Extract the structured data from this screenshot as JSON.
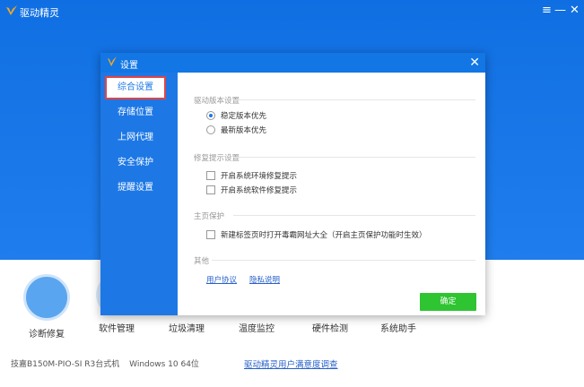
{
  "app": {
    "title": "驱动精灵",
    "window_controls": [
      "≡",
      "—",
      "✕"
    ],
    "features": [
      {
        "label": "诊断修复",
        "icon": "window-repair-icon",
        "color": "#5aa5ef"
      },
      {
        "label": "软件管理",
        "icon": "software-manage-icon",
        "color": "#e7f1fb"
      },
      {
        "label": "垃圾清理",
        "icon": "trash-clean-icon",
        "color": "#eef6ee"
      },
      {
        "label": "温度监控",
        "icon": "thermometer-icon",
        "color": "#f3eefb"
      },
      {
        "label": "硬件检测",
        "icon": "hardware-check-icon",
        "color": "#eaf2fb"
      },
      {
        "label": "系统助手",
        "icon": "system-assistant-icon",
        "color": "#f4eefa"
      }
    ],
    "status": {
      "board": "技嘉B150M-PIO-SI R3台式机",
      "os": "Windows 10 64位",
      "feedback_link": "驱动精灵用户满意度调查"
    }
  },
  "dialog": {
    "title": "设置",
    "close": "✕",
    "nav": [
      "综合设置",
      "存储位置",
      "上网代理",
      "安全保护",
      "提醒设置"
    ],
    "active_nav": "综合设置",
    "sections": {
      "driver_version": {
        "title": "驱动版本设置",
        "options": [
          "稳定版本优先",
          "最新版本优先"
        ],
        "selected": "稳定版本优先"
      },
      "repair_hint": {
        "title": "修复提示设置",
        "options": [
          "开启系统环境修复提示",
          "开启系统软件修复提示"
        ]
      },
      "homepage": {
        "title": "主页保护",
        "option": "新建标签页时打开毒霸网址大全（开启主页保护功能时生效）"
      },
      "other": {
        "title": "其他",
        "links": [
          "用户协议",
          "隐私说明"
        ]
      }
    },
    "ok_button": "确定",
    "colors": {
      "accent": "#1d78e6",
      "ok": "#2fc432",
      "highlight": "#e04545"
    }
  }
}
